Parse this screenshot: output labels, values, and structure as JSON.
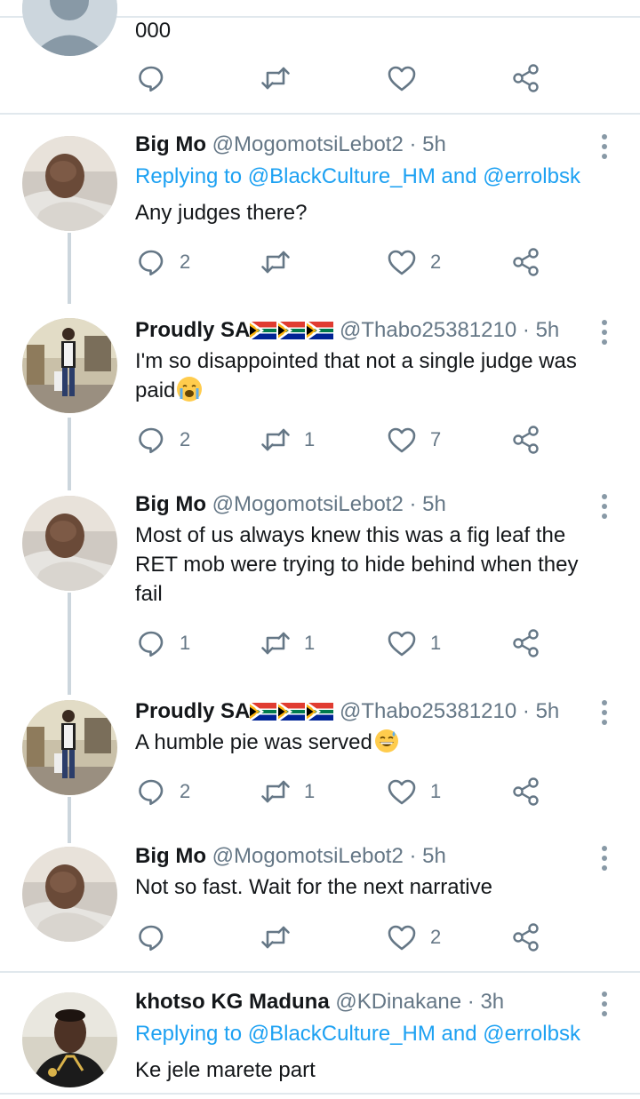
{
  "top_tweet": {
    "text": "000",
    "counts": {
      "reply": "",
      "retweet": "",
      "like": ""
    }
  },
  "tweets": [
    {
      "name": "Big Mo",
      "handle": "@MogomotsiLebot2",
      "time": "· 5h",
      "replying_label": "Replying to",
      "replying_users": "@BlackCulture_HM and @errolbsk",
      "text": "Any judges there?",
      "counts": {
        "reply": "2",
        "retweet": "",
        "like": "2"
      }
    },
    {
      "name": "Proudly SA",
      "handle": "@Thabo25381210",
      "time": "· 5h",
      "text": "I'm so disappointed that not a single judge was paid",
      "emoji": "loudly-crying-face",
      "counts": {
        "reply": "2",
        "retweet": "1",
        "like": "7"
      }
    },
    {
      "name": "Big Mo",
      "handle": "@MogomotsiLebot2",
      "time": "· 5h",
      "text": "Most of us always knew this was a fig leaf the RET mob were trying to hide behind when they fail",
      "counts": {
        "reply": "1",
        "retweet": "1",
        "like": "1"
      }
    },
    {
      "name": "Proudly SA",
      "handle": "@Thabo25381210",
      "time": "· 5h",
      "text": "A humble pie was served",
      "emoji": "grinning-face-with-sweat",
      "counts": {
        "reply": "2",
        "retweet": "1",
        "like": "1"
      }
    },
    {
      "name": "Big Mo",
      "handle": "@MogomotsiLebot2",
      "time": "· 5h",
      "text": "Not so fast. Wait for the next narrative",
      "counts": {
        "reply": "",
        "retweet": "",
        "like": "2"
      }
    },
    {
      "name": "khotso KG Maduna",
      "handle": "@KDinakane",
      "time": "· 3h",
      "replying_label": "Replying to",
      "replying_users": "@BlackCulture_HM and @errolbsk",
      "text": "Ke jele marete part"
    }
  ],
  "colors": {
    "link": "#1da1f2",
    "muted": "#657786",
    "divider": "#e1e8ed",
    "thread_line": "#ccd6dd"
  },
  "icons": [
    "reply-icon",
    "retweet-icon",
    "like-icon",
    "share-icon",
    "more-options-icon",
    "south-africa-flag-icon"
  ]
}
